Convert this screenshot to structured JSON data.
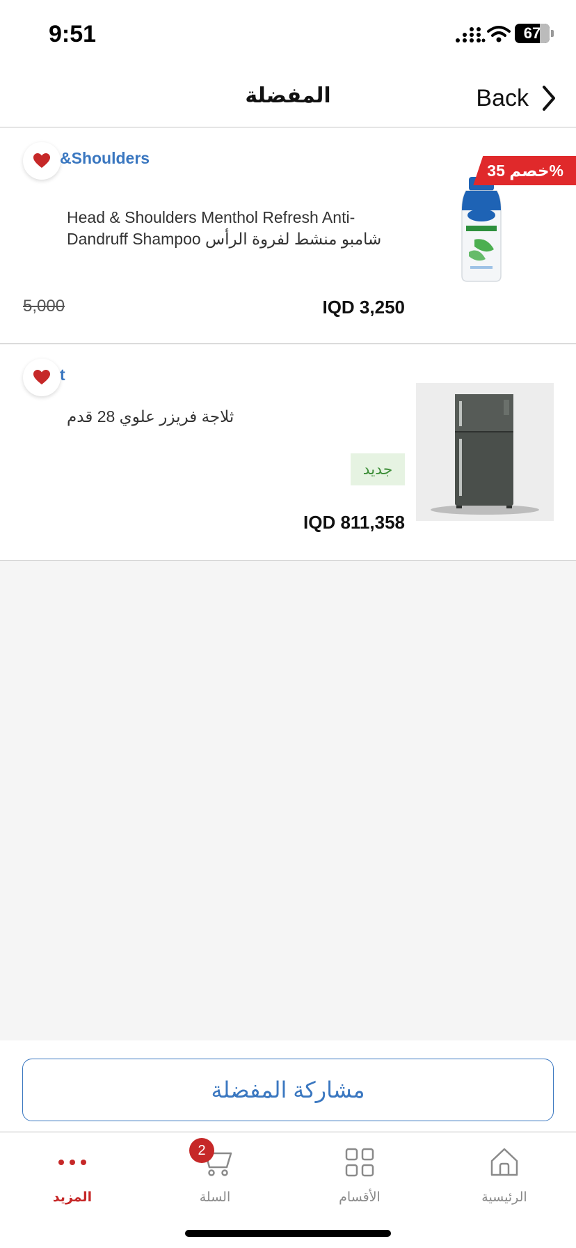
{
  "status_bar": {
    "time": "9:51",
    "battery": "67"
  },
  "header": {
    "title": "المفضلة",
    "back_label": "Back"
  },
  "items": [
    {
      "brand": "&Shoulders",
      "name": "Head & Shoulders Menthol Refresh Anti-Dandruff Shampoo شامبو منشط لفروة الرأس",
      "price": "IQD 3,250",
      "old_price": "5,000",
      "discount": "خصم 35%",
      "favorited": true
    },
    {
      "brand": "t",
      "name": "ثلاجة فريزر علوي 28 قدم",
      "price": "IQD 811,358",
      "badge": "جديد",
      "favorited": true
    }
  ],
  "share_button": "مشاركة المفضلة",
  "tabs": [
    {
      "label": "المزيد",
      "icon": "more-dots-icon",
      "active": true
    },
    {
      "label": "السلة",
      "icon": "cart-icon",
      "badge": "2"
    },
    {
      "label": "الأقسام",
      "icon": "grid-icon"
    },
    {
      "label": "الرئيسية",
      "icon": "home-icon"
    }
  ],
  "colors": {
    "accent_red": "#e0292b",
    "brand_blue": "#3a77c0",
    "new_green": "#3f8f3a"
  }
}
